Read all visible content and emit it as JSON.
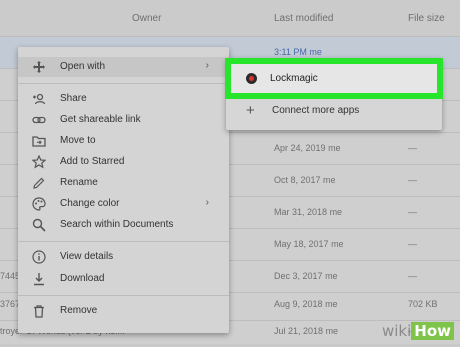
{
  "header": {
    "owner": "Owner",
    "last_modified": "Last modified",
    "file_size": "File size"
  },
  "rows": [
    {
      "name": "",
      "modified": "3:11 PM",
      "by": "me",
      "size": ""
    },
    {
      "name": "",
      "modified": "",
      "by": "",
      "size": ""
    },
    {
      "name": "",
      "modified": "",
      "by": "",
      "size": ""
    },
    {
      "name": "",
      "modified": "Apr 24, 2019",
      "by": "me",
      "size": "—"
    },
    {
      "name": "",
      "modified": "Oct 8, 2017",
      "by": "me",
      "size": "—"
    },
    {
      "name": "",
      "modified": "Mar 31, 2018",
      "by": "me",
      "size": "—"
    },
    {
      "name": "",
      "modified": "May 18, 2017",
      "by": "me",
      "size": "—"
    },
    {
      "name": "7445",
      "modified": "Dec 3, 2017",
      "by": "me",
      "size": "—"
    },
    {
      "name": "3767-",
      "modified": "Aug 9, 2018",
      "by": "me",
      "size": "702 KB"
    },
    {
      "name": "troyer Of Worlds (ver 2 by h3l...",
      "modified": "Jul 21, 2018",
      "by": "me",
      "size": "—"
    }
  ],
  "context_menu": {
    "items": [
      {
        "label": "Open with",
        "icon": "move-arrows-icon"
      },
      {
        "label": "Share",
        "icon": "add-person-icon"
      },
      {
        "label": "Get shareable link",
        "icon": "link-icon"
      },
      {
        "label": "Move to",
        "icon": "folder-move-icon"
      },
      {
        "label": "Add to Starred",
        "icon": "star-icon"
      },
      {
        "label": "Rename",
        "icon": "pencil-icon"
      },
      {
        "label": "Change color",
        "icon": "palette-icon"
      },
      {
        "label": "Search within Documents",
        "icon": "search-icon"
      },
      {
        "label": "View details",
        "icon": "info-icon"
      },
      {
        "label": "Download",
        "icon": "download-icon"
      },
      {
        "label": "Remove",
        "icon": "trash-icon"
      }
    ]
  },
  "submenu": {
    "app_label": "Lockmagic",
    "connect_label": "Connect more apps"
  },
  "watermark": {
    "wiki": "wiki",
    "how": "How"
  },
  "colors": {
    "highlight": "#27e52a",
    "selected_row": "#c2cad6"
  }
}
